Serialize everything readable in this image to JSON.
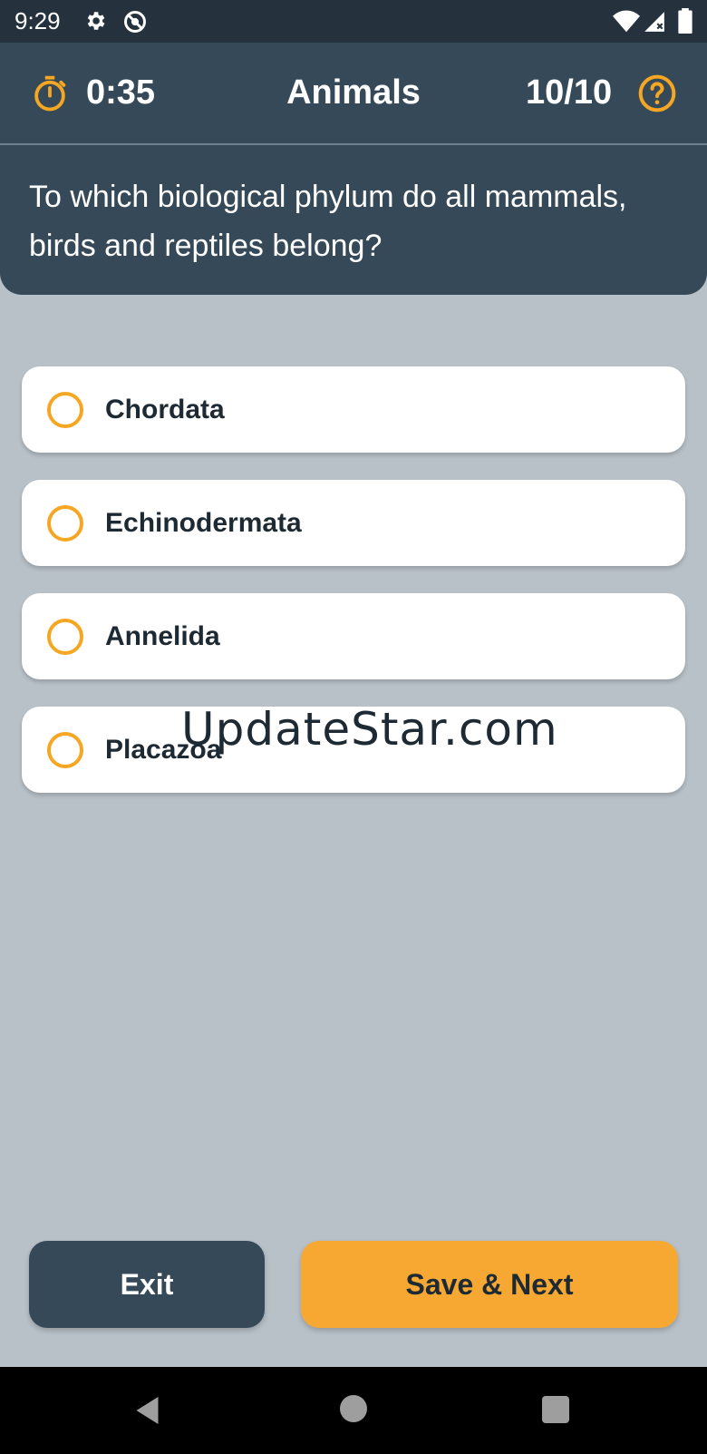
{
  "status_bar": {
    "time": "9:29",
    "icons": [
      "gear-icon",
      "dnd-icon",
      "wifi-icon",
      "signal-icon",
      "battery-icon"
    ]
  },
  "header": {
    "timer_icon": "stopwatch-icon",
    "timer": "0:35",
    "topic": "Animals",
    "progress": "10/10",
    "help_icon": "help-icon"
  },
  "question": {
    "text": "To which biological phylum do all mammals, birds and reptiles belong?"
  },
  "options": [
    {
      "label": "Chordata"
    },
    {
      "label": "Echinodermata"
    },
    {
      "label": "Annelida"
    },
    {
      "label": "Placazoa"
    }
  ],
  "watermark": "UpdateStar.com",
  "buttons": {
    "exit": "Exit",
    "save_next": "Save & Next"
  },
  "nav_bar": {
    "icons": [
      "back-icon",
      "home-icon",
      "recents-icon"
    ]
  },
  "colors": {
    "accent": "#f5a623",
    "header_bg": "#364958",
    "page_bg": "#b8c1c8"
  }
}
